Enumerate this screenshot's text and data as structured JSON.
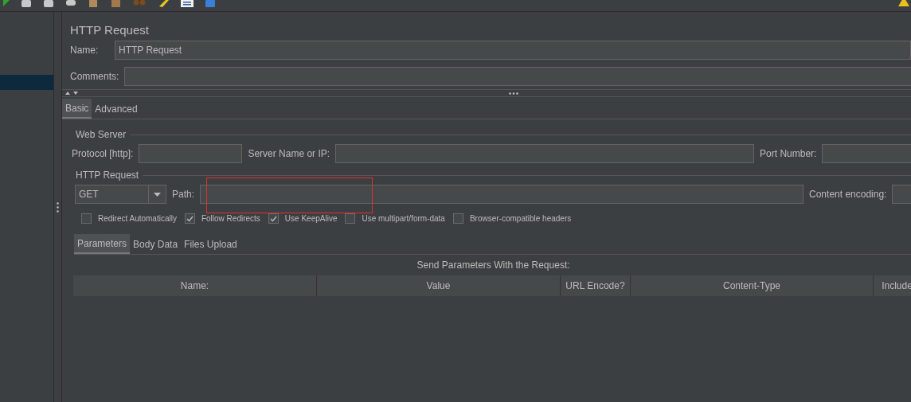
{
  "sidebar": {
    "items": [
      {
        "selected": true
      }
    ]
  },
  "panel": {
    "title": "HTTP Request",
    "name": {
      "label": "Name:",
      "value": "HTTP Request"
    },
    "comments": {
      "label": "Comments:"
    },
    "tabs": [
      {
        "label": "Basic",
        "selected": true
      },
      {
        "label": "Advanced",
        "selected": false
      }
    ],
    "web_server": {
      "title": "Web Server",
      "protocol_label": "Protocol [http]:",
      "server_label": "Server Name or IP:",
      "port_label": "Port Number:"
    },
    "http_request": {
      "title": "HTTP Request",
      "method": "GET",
      "path_label": "Path:",
      "encoding_label": "Content encoding:"
    },
    "options": [
      {
        "label": "Redirect Automatically",
        "checked": false
      },
      {
        "label": "Follow Redirects",
        "checked": true
      },
      {
        "label": "Use KeepAlive",
        "checked": true
      },
      {
        "label": "Use multipart/form-data",
        "checked": false
      },
      {
        "label": "Browser-compatible headers",
        "checked": false
      }
    ],
    "sub_tabs": [
      {
        "label": "Parameters",
        "selected": true
      },
      {
        "label": "Body Data",
        "selected": false
      },
      {
        "label": "Files Upload",
        "selected": false
      }
    ],
    "table": {
      "caption": "Send Parameters With the Request:",
      "columns": [
        "Name:",
        "Value",
        "URL Encode?",
        "Content-Type",
        "Include"
      ]
    }
  }
}
